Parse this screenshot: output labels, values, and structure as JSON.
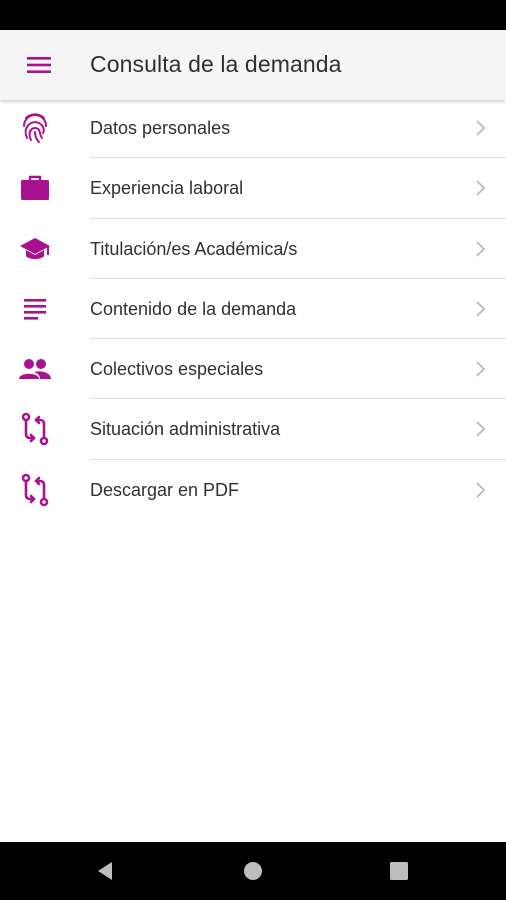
{
  "colors": {
    "accent": "#a8118f",
    "title_text": "#2f2f2f",
    "item_text": "#303030",
    "divider": "#dedede",
    "chevron": "#b8b8b8",
    "app_bar_bg": "#f5f5f5",
    "system_bar_bg": "#000000",
    "nav_icons": "#bdbdbd"
  },
  "app_bar": {
    "menu_icon": "hamburger-menu-icon",
    "title": "Consulta de la demanda"
  },
  "menu": {
    "items": [
      {
        "label": "Datos personales",
        "icon": "fingerprint-icon"
      },
      {
        "label": "Experiencia laboral",
        "icon": "briefcase-icon"
      },
      {
        "label": "Titulación/es Académica/s",
        "icon": "graduation-cap-icon"
      },
      {
        "label": "Contenido de la demanda",
        "icon": "text-lines-icon"
      },
      {
        "label": "Colectivos especiales",
        "icon": "people-icon"
      },
      {
        "label": "Situación administrativa",
        "icon": "compare-arrows-icon"
      },
      {
        "label": "Descargar en PDF",
        "icon": "compare-arrows-icon"
      }
    ]
  },
  "nav_bar": {
    "buttons": [
      "back-triangle-icon",
      "home-circle-icon",
      "recents-square-icon"
    ]
  }
}
